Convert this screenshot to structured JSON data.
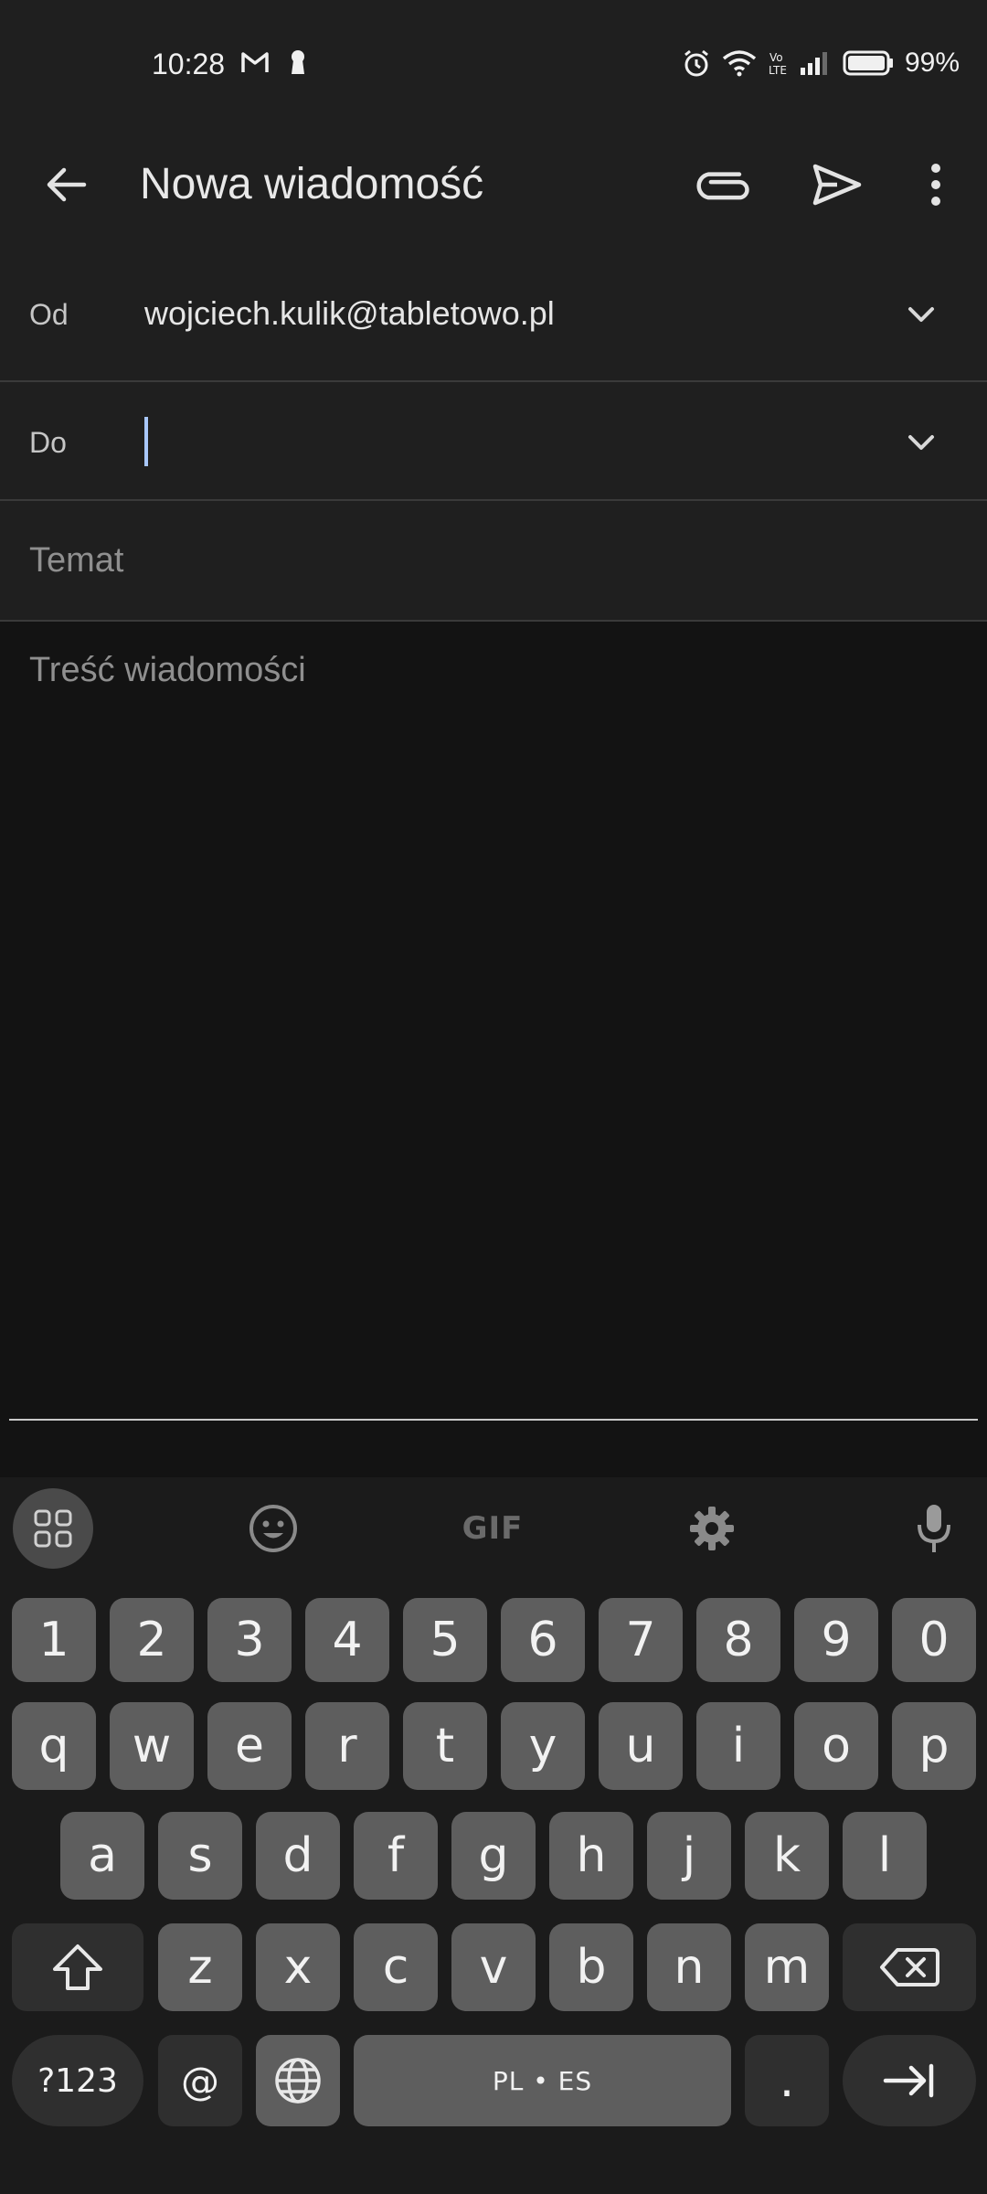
{
  "status_bar": {
    "time": "10:28",
    "battery": "99%",
    "left_icons": [
      "gmail-icon",
      "keyhole-icon"
    ],
    "right_icons": [
      "alarm-icon",
      "wifi-icon",
      "volte-icon",
      "signal-icon",
      "battery-icon"
    ]
  },
  "app_bar": {
    "title": "Nowa wiadomość",
    "icons": [
      "back-arrow-icon",
      "attach-icon",
      "send-icon",
      "more-vert-icon"
    ]
  },
  "compose": {
    "from_label": "Od",
    "from_value": "wojciech.kulik@tabletowo.pl",
    "to_label": "Do",
    "to_value": "",
    "subject_placeholder": "Temat",
    "body_placeholder": "Treść wiadomości"
  },
  "keyboard": {
    "toolbar": [
      "apps-grid-icon",
      "emoji-icon",
      "GIF",
      "settings-gear-icon",
      "microphone-icon"
    ],
    "row_numbers": [
      "1",
      "2",
      "3",
      "4",
      "5",
      "6",
      "7",
      "8",
      "9",
      "0"
    ],
    "row_q": [
      "q",
      "w",
      "e",
      "r",
      "t",
      "y",
      "u",
      "i",
      "o",
      "p"
    ],
    "row_a": [
      "a",
      "s",
      "d",
      "f",
      "g",
      "h",
      "j",
      "k",
      "l"
    ],
    "row_z": [
      "z",
      "x",
      "c",
      "v",
      "b",
      "n",
      "m"
    ],
    "symbols_key": "?123",
    "at_key": "@",
    "space_label": "PL • ES",
    "period_key": ".",
    "colors": {
      "key": "#5e5e5e",
      "key_dark": "#2f2f2f",
      "background": "#1b1b1b"
    }
  }
}
